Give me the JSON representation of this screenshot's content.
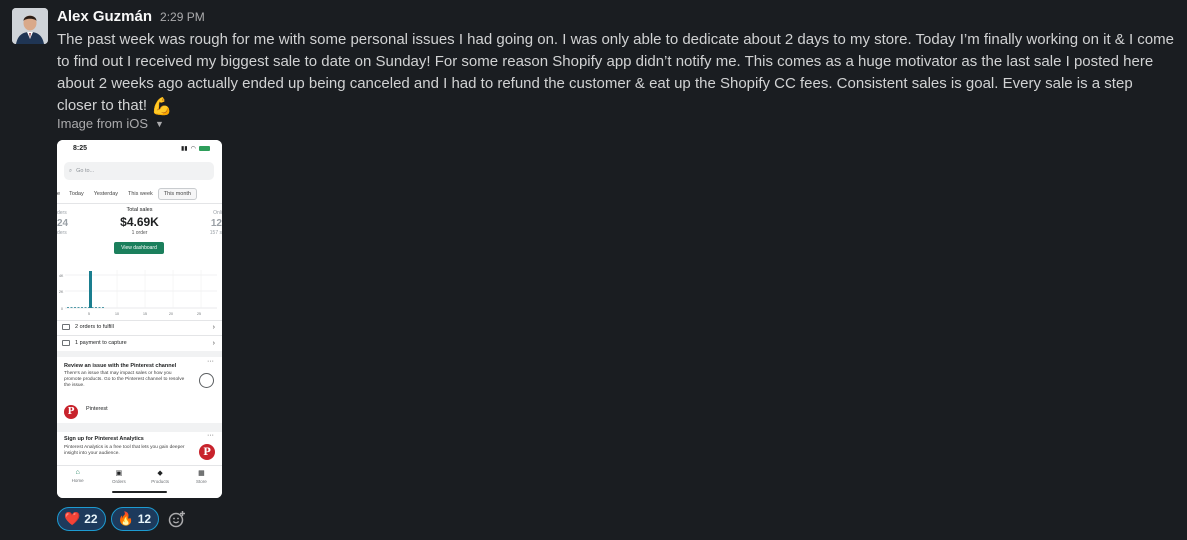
{
  "message": {
    "author": "Alex Guzmán",
    "time": "2:29 PM",
    "text": "The past week was rough for me with some personal issues I had going on. I was only able to dedicate about 2 days to my store. Today I’m finally working on it & I come to find out I received my biggest sale to date on Sunday! For some reason Shopify app didn’t notify me. This comes as a huge motivator as the last sale I posted here about 2 weeks ago actually ended up being canceled and I had to refund the customer & eat up the Shopify CC fees. Consistent sales is goal. Every sale is a step closer to that!",
    "trailing_emoji": "💪"
  },
  "attachment": {
    "label": "Image from iOS",
    "phone": {
      "status_time": "8:25",
      "search_placeholder": "Go to...",
      "tabs": [
        "e",
        "Today",
        "Yesterday",
        "This week",
        "This month"
      ],
      "active_tab": "This month",
      "left_partial": {
        "label": "ders",
        "value": "24",
        "sub": "ders"
      },
      "right_partial": {
        "label": "Onli",
        "value": "12",
        "sub": "157 s"
      },
      "total_sales_label": "Total sales",
      "total_sales_value": "$4.69K",
      "orders_count": "1 order",
      "dashboard_button": "View dashboard",
      "chart_y_ticks": [
        "4K",
        "2K",
        "0"
      ],
      "chart_x_ticks": [
        "5",
        "10",
        "15",
        "20",
        "25",
        "30"
      ],
      "row_orders": "2 orders to fulfill",
      "row_payment": "1 payment to capture",
      "card1": {
        "title": "Review an issue with the Pinterest channel",
        "body": "There's an issue that may impact sales or how you promote products. Go to the Pinterest channel to resolve the issue.",
        "channel": "Pinterest"
      },
      "card2": {
        "title": "Sign up for Pinterest Analytics",
        "body": "Pinterest Analytics is a free tool that lets you gain deeper insight into your audience."
      },
      "nav": [
        "Home",
        "Orders",
        "Products",
        "Store"
      ]
    }
  },
  "reactions": [
    {
      "emoji": "❤️",
      "count": "22"
    },
    {
      "emoji": "🔥",
      "count": "12"
    }
  ],
  "colors": {
    "background": "#1a1d21",
    "reaction_border": "#1d9bd1",
    "shopify_green": "#1b7f5c",
    "pinterest_red": "#c8232c"
  }
}
